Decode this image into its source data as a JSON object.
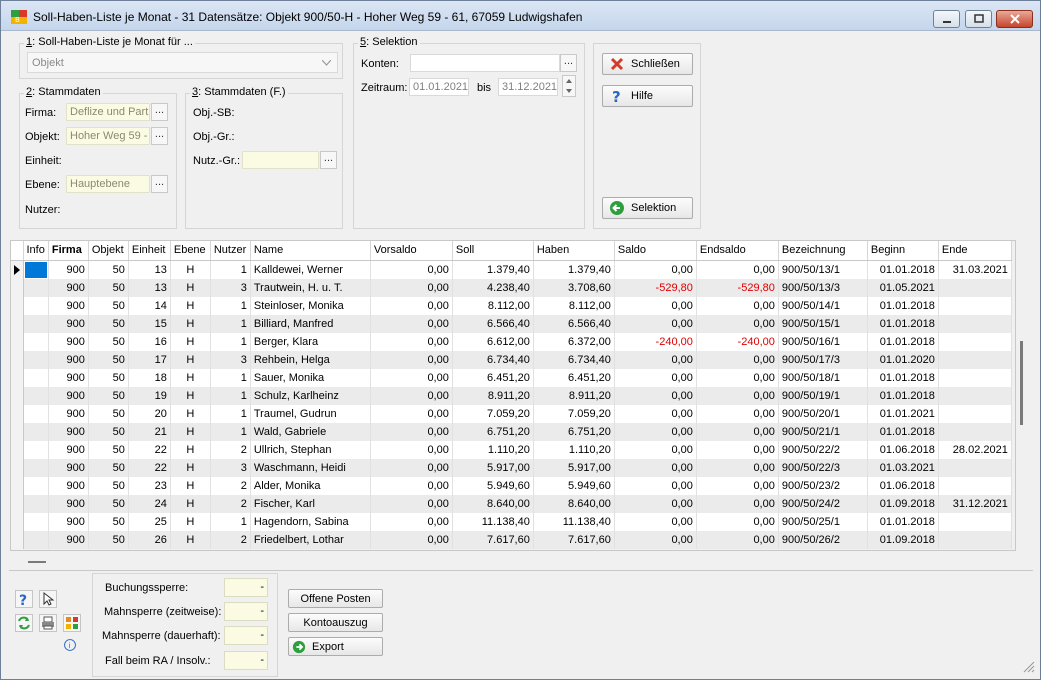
{
  "window": {
    "title": "Soll-Haben-Liste je Monat - 31 Datensätze:  Objekt 900/50-H - Hoher Weg 59 - 61, 67059 Ludwigshafen",
    "icon": "app-logo-icon",
    "controls": [
      "minimize-icon",
      "maximize-icon",
      "close-icon"
    ]
  },
  "section1": {
    "legend_num": "1",
    "legend_text": ": Soll-Haben-Liste je Monat für ...",
    "combo_value": "Objekt"
  },
  "section2": {
    "legend_num": "2",
    "legend_text": ": Stammdaten",
    "firma_label": "Firma:",
    "firma_value": "Deflize und Partr",
    "objekt_label": "Objekt:",
    "objekt_value": "Hoher Weg 59 -",
    "einheit_label": "Einheit:",
    "ebene_label": "Ebene:",
    "ebene_value": "Hauptebene",
    "nutzer_label": "Nutzer:",
    "dots": "..."
  },
  "section3": {
    "legend_num": "3",
    "legend_text": ": Stammdaten (F.)",
    "objsb_label": "Obj.-SB:",
    "objgr_label": "Obj.-Gr.:",
    "nutzgr_label": "Nutz.-Gr.:",
    "dots": "..."
  },
  "section5": {
    "legend_num": "5",
    "legend_text": ": Selektion",
    "konten_label": "Konten:",
    "zeitraum_label": "Zeitraum:",
    "date_from": "01.01.2021",
    "bis_label": "bis",
    "date_to": "31.12.2021",
    "dots": "..."
  },
  "buttons": {
    "schliessen": "Schließen",
    "hilfe": "Hilfe",
    "selektion": "Selektion",
    "offene_posten": "Offene Posten",
    "kontoauszug": "Kontoauszug",
    "export": "Export"
  },
  "grid": {
    "columns": [
      "Info",
      "Firma",
      "Objekt",
      "Einheit",
      "Ebene",
      "Nutzer",
      "Name",
      "Vorsaldo",
      "Soll",
      "Haben",
      "Saldo",
      "Endsaldo",
      "Bezeichnung",
      "Beginn",
      "Ende"
    ],
    "rows": [
      [
        "900",
        "50",
        "13",
        "H",
        "1",
        "Kalldewei, Werner",
        "0,00",
        "1.379,40",
        "1.379,40",
        "0,00",
        "0,00",
        "900/50/13/1",
        "01.01.2018",
        "31.03.2021"
      ],
      [
        "900",
        "50",
        "13",
        "H",
        "3",
        "Trautwein, H. u. T.",
        "0,00",
        "4.238,40",
        "3.708,60",
        "-529,80",
        "-529,80",
        "900/50/13/3",
        "01.05.2021",
        ""
      ],
      [
        "900",
        "50",
        "14",
        "H",
        "1",
        "Steinloser, Monika",
        "0,00",
        "8.112,00",
        "8.112,00",
        "0,00",
        "0,00",
        "900/50/14/1",
        "01.01.2018",
        ""
      ],
      [
        "900",
        "50",
        "15",
        "H",
        "1",
        "Billiard, Manfred",
        "0,00",
        "6.566,40",
        "6.566,40",
        "0,00",
        "0,00",
        "900/50/15/1",
        "01.01.2018",
        ""
      ],
      [
        "900",
        "50",
        "16",
        "H",
        "1",
        "Berger, Klara",
        "0,00",
        "6.612,00",
        "6.372,00",
        "-240,00",
        "-240,00",
        "900/50/16/1",
        "01.01.2018",
        ""
      ],
      [
        "900",
        "50",
        "17",
        "H",
        "3",
        "Rehbein, Helga",
        "0,00",
        "6.734,40",
        "6.734,40",
        "0,00",
        "0,00",
        "900/50/17/3",
        "01.01.2020",
        ""
      ],
      [
        "900",
        "50",
        "18",
        "H",
        "1",
        "Sauer, Monika",
        "0,00",
        "6.451,20",
        "6.451,20",
        "0,00",
        "0,00",
        "900/50/18/1",
        "01.01.2018",
        ""
      ],
      [
        "900",
        "50",
        "19",
        "H",
        "1",
        "Schulz, Karlheinz",
        "0,00",
        "8.911,20",
        "8.911,20",
        "0,00",
        "0,00",
        "900/50/19/1",
        "01.01.2018",
        ""
      ],
      [
        "900",
        "50",
        "20",
        "H",
        "1",
        "Traumel, Gudrun",
        "0,00",
        "7.059,20",
        "7.059,20",
        "0,00",
        "0,00",
        "900/50/20/1",
        "01.01.2021",
        ""
      ],
      [
        "900",
        "50",
        "21",
        "H",
        "1",
        "Wald, Gabriele",
        "0,00",
        "6.751,20",
        "6.751,20",
        "0,00",
        "0,00",
        "900/50/21/1",
        "01.01.2018",
        ""
      ],
      [
        "900",
        "50",
        "22",
        "H",
        "2",
        "Ullrich, Stephan",
        "0,00",
        "1.110,20",
        "1.110,20",
        "0,00",
        "0,00",
        "900/50/22/2",
        "01.06.2018",
        "28.02.2021"
      ],
      [
        "900",
        "50",
        "22",
        "H",
        "3",
        "Waschmann, Heidi",
        "0,00",
        "5.917,00",
        "5.917,00",
        "0,00",
        "0,00",
        "900/50/22/3",
        "01.03.2021",
        ""
      ],
      [
        "900",
        "50",
        "23",
        "H",
        "2",
        "Alder, Monika",
        "0,00",
        "5.949,60",
        "5.949,60",
        "0,00",
        "0,00",
        "900/50/23/2",
        "01.06.2018",
        ""
      ],
      [
        "900",
        "50",
        "24",
        "H",
        "2",
        "Fischer, Karl",
        "0,00",
        "8.640,00",
        "8.640,00",
        "0,00",
        "0,00",
        "900/50/24/2",
        "01.09.2018",
        "31.12.2021"
      ],
      [
        "900",
        "50",
        "25",
        "H",
        "1",
        "Hagendorn, Sabina",
        "0,00",
        "11.138,40",
        "11.138,40",
        "0,00",
        "0,00",
        "900/50/25/1",
        "01.01.2018",
        ""
      ],
      [
        "900",
        "50",
        "26",
        "H",
        "2",
        "Friedelbert, Lothar",
        "0,00",
        "7.617,60",
        "7.617,60",
        "0,00",
        "0,00",
        "900/50/26/2",
        "01.09.2018",
        ""
      ]
    ]
  },
  "flags": {
    "buchungssperre_label": "Buchungssperre:",
    "buchungssperre_value": "-",
    "mahnsperre_zeit_label": "Mahnsperre (zeitweise):",
    "mahnsperre_zeit_value": "-",
    "mahnsperre_dauer_label": "Mahnsperre (dauerhaft):",
    "mahnsperre_dauer_value": "-",
    "fall_ra_label": "Fall beim RA / Insolv.:",
    "fall_ra_value": "-"
  },
  "colors": {
    "negative": "#e00000",
    "input_yellow": "#fbfbe3",
    "selection_blue": "#0078d7"
  }
}
